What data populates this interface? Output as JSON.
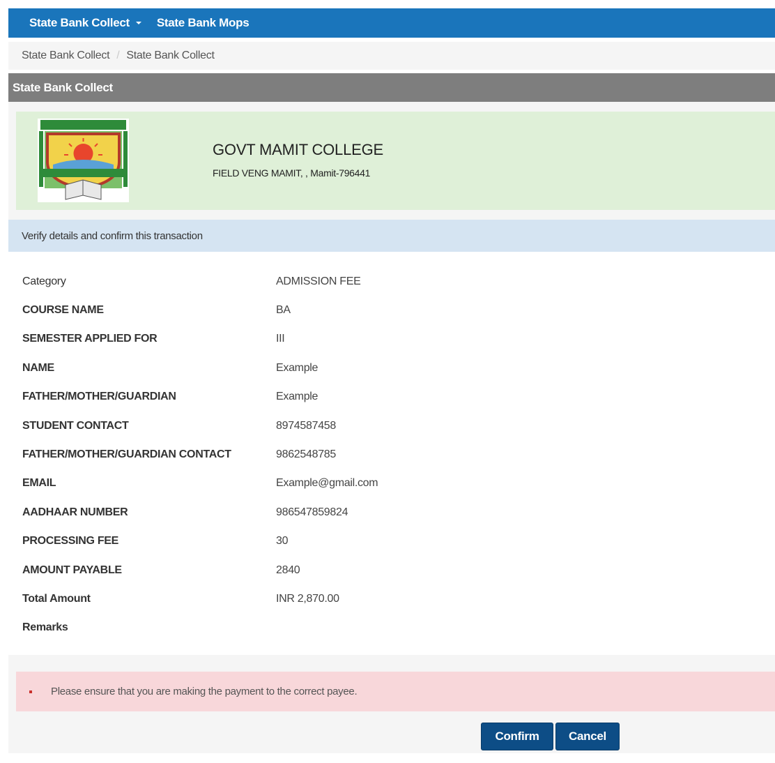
{
  "navbar": {
    "items": [
      {
        "label": "State Bank Collect",
        "has_dropdown": true
      },
      {
        "label": "State Bank Mops",
        "has_dropdown": false
      }
    ],
    "color": "#1a75bb"
  },
  "breadcrumb": {
    "items": [
      "State Bank Collect",
      "State Bank Collect"
    ],
    "separator": "/"
  },
  "panel": {
    "title": "State Bank Collect"
  },
  "college": {
    "logo_icon": "college-crest-logo",
    "name": "GOVT MAMIT COLLEGE",
    "address": "FIELD VENG MAMIT, , Mamit-796441"
  },
  "verify_message": "Verify details and confirm this transaction",
  "details": [
    {
      "label": "Category",
      "value": "ADMISSION FEE",
      "bold": false
    },
    {
      "label": "COURSE NAME",
      "value": "BA",
      "bold": true
    },
    {
      "label": "SEMESTER APPLIED FOR",
      "value": "III",
      "bold": true
    },
    {
      "label": "NAME",
      "value": "Example",
      "bold": true
    },
    {
      "label": "FATHER/MOTHER/GUARDIAN",
      "value": "Example",
      "bold": true
    },
    {
      "label": "STUDENT CONTACT",
      "value": "8974587458",
      "bold": true
    },
    {
      "label": "FATHER/MOTHER/GUARDIAN CONTACT",
      "value": "9862548785",
      "bold": true
    },
    {
      "label": "EMAIL",
      "value": "Example@gmail.com",
      "bold": true
    },
    {
      "label": "AADHAAR NUMBER",
      "value": "986547859824",
      "bold": true
    },
    {
      "label": "PROCESSING FEE",
      "value": "30",
      "bold": true
    },
    {
      "label": "AMOUNT PAYABLE",
      "value": "2840",
      "bold": true
    },
    {
      "label": "Total Amount",
      "value": "INR 2,870.00",
      "bold": true
    },
    {
      "label": "Remarks",
      "value": "",
      "bold": true
    }
  ],
  "alert": {
    "message": "Please ensure that you are making the payment to the correct payee."
  },
  "buttons": {
    "confirm_label": "Confirm",
    "cancel_label": "Cancel"
  }
}
